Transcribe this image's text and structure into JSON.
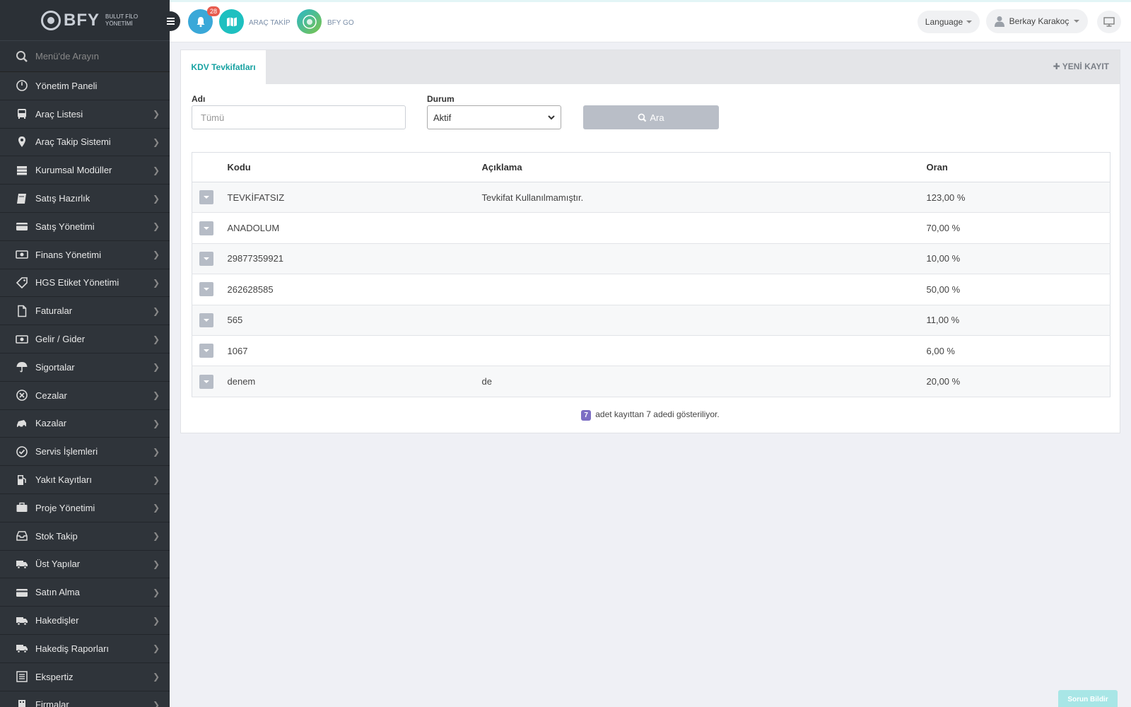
{
  "brand": {
    "name": "BFY",
    "subtitle": "BULUT FİLO YÖNETİMİ"
  },
  "sidebar": {
    "search_placeholder": "Menü'de Arayın",
    "items": [
      {
        "label": "Yönetim Paneli",
        "icon": "dashboard-icon",
        "chevron": false
      },
      {
        "label": "Araç Listesi",
        "icon": "bus-icon",
        "chevron": true
      },
      {
        "label": "Araç Takip Sistemi",
        "icon": "map-pin-icon",
        "chevron": true
      },
      {
        "label": "Kurumsal Modüller",
        "icon": "server-icon",
        "chevron": true
      },
      {
        "label": "Satış Hazırlık",
        "icon": "book-icon",
        "chevron": true
      },
      {
        "label": "Satış Yönetimi",
        "icon": "credit-card-icon",
        "chevron": true
      },
      {
        "label": "Finans Yönetimi",
        "icon": "money-icon",
        "chevron": true
      },
      {
        "label": "HGS Etiket Yönetimi",
        "icon": "tag-icon",
        "chevron": true
      },
      {
        "label": "Faturalar",
        "icon": "file-icon",
        "chevron": true
      },
      {
        "label": "Gelir / Gider",
        "icon": "money-icon",
        "chevron": true
      },
      {
        "label": "Sigortalar",
        "icon": "umbrella-icon",
        "chevron": true
      },
      {
        "label": "Cezalar",
        "icon": "times-circle-icon",
        "chevron": true
      },
      {
        "label": "Kazalar",
        "icon": "car-crash-icon",
        "chevron": true
      },
      {
        "label": "Servis İşlemleri",
        "icon": "check-circle-icon",
        "chevron": true
      },
      {
        "label": "Yakıt Kayıtları",
        "icon": "gas-pump-icon",
        "chevron": true
      },
      {
        "label": "Proje Yönetimi",
        "icon": "briefcase-icon",
        "chevron": true
      },
      {
        "label": "Stok Takip",
        "icon": "inbox-icon",
        "chevron": true
      },
      {
        "label": "Üst Yapılar",
        "icon": "truck-icon",
        "chevron": true
      },
      {
        "label": "Satın Alma",
        "icon": "credit-card-icon",
        "chevron": true
      },
      {
        "label": "Hakedişler",
        "icon": "truck-icon",
        "chevron": true
      },
      {
        "label": "Hakediş Raporları",
        "icon": "truck-icon",
        "chevron": true
      },
      {
        "label": "Ekspertiz",
        "icon": "list-alt-icon",
        "chevron": true
      },
      {
        "label": "Firmalar",
        "icon": "building-icon",
        "chevron": true
      }
    ]
  },
  "topbar": {
    "notification_count": "28",
    "arac_takip_label": "ARAÇ TAKİP",
    "bfy_go_label": "BFY GO",
    "language_label": "Language",
    "user_name": "Berkay Karakoç"
  },
  "panel": {
    "tab_label": "KDV Tevkifatları",
    "new_record_label": "YENİ KAYIT",
    "filters": {
      "name_label": "Adı",
      "name_placeholder": "Tümü",
      "status_label": "Durum",
      "status_value": "Aktif",
      "search_button": "Ara"
    },
    "table": {
      "columns": [
        "Kodu",
        "Açıklama",
        "Oran"
      ],
      "rows": [
        {
          "kodu": "TEVKİFATSIZ",
          "aciklama": "Tevkifat Kullanılmamıştır.",
          "oran": "123,00 %"
        },
        {
          "kodu": "ANADOLUM",
          "aciklama": "",
          "oran": "70,00 %"
        },
        {
          "kodu": "29877359921",
          "aciklama": "",
          "oran": "10,00 %"
        },
        {
          "kodu": "262628585",
          "aciklama": "",
          "oran": "50,00 %"
        },
        {
          "kodu": "565",
          "aciklama": "",
          "oran": "11,00 %"
        },
        {
          "kodu": "1067",
          "aciklama": "",
          "oran": "6,00 %"
        },
        {
          "kodu": "denem",
          "aciklama": "de",
          "oran": "20,00 %"
        }
      ]
    },
    "footer": {
      "count": "7",
      "text": "adet kayıttan 7 adedi gösteriliyor."
    }
  },
  "report_button": "Sorun Bildir",
  "colors": {
    "accent": "#17a2a2",
    "sidebar_bg": "#2a2f35",
    "badge_red": "#e85c4f",
    "count_badge": "#7c6ec4"
  }
}
